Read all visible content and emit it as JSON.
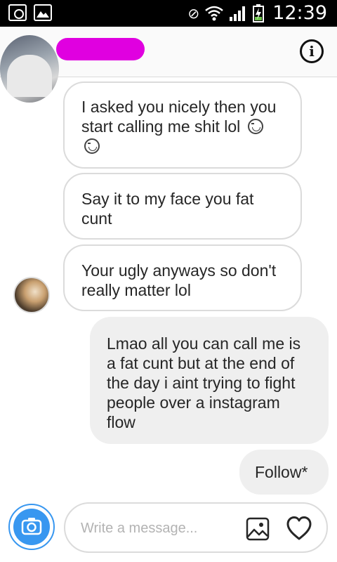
{
  "status_bar": {
    "time": "12:39",
    "icons": [
      "instagram-icon",
      "gallery-icon",
      "mute-icon",
      "wifi-icon",
      "signal-icon",
      "battery-charging-icon"
    ]
  },
  "header": {
    "info_icon": "info-icon"
  },
  "messages": [
    {
      "direction": "incoming",
      "text": "I asked you nicely then you start calling me shit lol"
    },
    {
      "direction": "incoming",
      "text": "Say it to my face you fat cunt"
    },
    {
      "direction": "incoming",
      "text": "Your ugly anyways so don't really matter lol"
    },
    {
      "direction": "outgoing",
      "text": "Lmao all you can call me is a fat cunt but at the end of the day i aint trying to fight people over a instagram flow"
    },
    {
      "direction": "outgoing",
      "text": "Follow*"
    }
  ],
  "composer": {
    "placeholder": "Write a message..."
  },
  "colors": {
    "accent": "#3897f0",
    "redaction": "#e000e0",
    "incoming_border": "#dbdbdb",
    "outgoing_bg": "#efefef"
  }
}
